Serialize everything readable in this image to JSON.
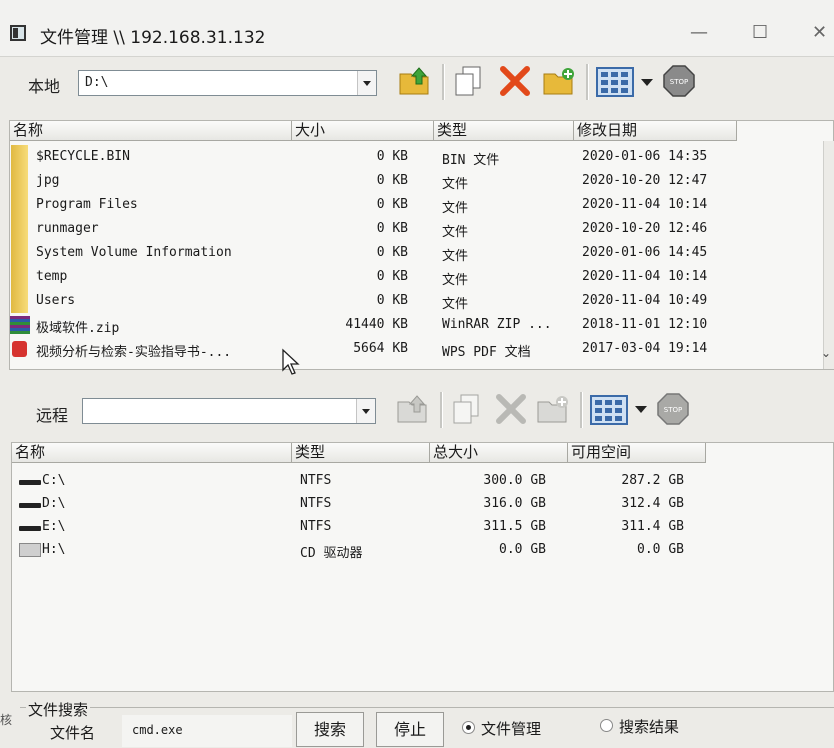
{
  "window": {
    "title": "文件管理 \\\\ 192.168.31.132",
    "minimize": "—",
    "maximize": "☐",
    "close": "✕"
  },
  "local": {
    "label": "本地",
    "path": "D:\\",
    "columns": [
      "名称",
      "大小",
      "类型",
      "修改日期"
    ],
    "files": [
      {
        "icon": "folder-icon",
        "name": "$RECYCLE.BIN",
        "size": "0 KB",
        "type": "BIN 文件",
        "date": "2020-01-06 14:35"
      },
      {
        "icon": "folder-icon",
        "name": "jpg",
        "size": "0 KB",
        "type": "文件",
        "date": "2020-10-20 12:47"
      },
      {
        "icon": "folder-icon",
        "name": "Program Files",
        "size": "0 KB",
        "type": "文件",
        "date": "2020-11-04 10:14"
      },
      {
        "icon": "folder-icon",
        "name": "runmager",
        "size": "0 KB",
        "type": "文件",
        "date": "2020-10-20 12:46"
      },
      {
        "icon": "folder-icon",
        "name": "System Volume Information",
        "size": "0 KB",
        "type": "文件",
        "date": "2020-01-06 14:45"
      },
      {
        "icon": "folder-icon",
        "name": "temp",
        "size": "0 KB",
        "type": "文件",
        "date": "2020-11-04 10:14"
      },
      {
        "icon": "folder-icon",
        "name": "Users",
        "size": "0 KB",
        "type": "文件",
        "date": "2020-11-04 10:49"
      },
      {
        "icon": "zip-icon",
        "name": "极域软件.zip",
        "size": "41440 KB",
        "type": "WinRAR ZIP ...",
        "date": "2018-11-01 12:10"
      },
      {
        "icon": "pdf-icon",
        "name": "视频分析与检索-实验指导书-...",
        "size": "5664 KB",
        "type": "WPS PDF 文档",
        "date": "2017-03-04 19:14"
      }
    ],
    "stop_label": "STOP"
  },
  "remote": {
    "label": "远程",
    "path": "",
    "columns": [
      "名称",
      "类型",
      "总大小",
      "可用空间"
    ],
    "drives": [
      {
        "icon": "drive-icon",
        "name": "C:\\",
        "type": "NTFS",
        "total": "300.0 GB",
        "free": "287.2 GB"
      },
      {
        "icon": "drive-icon",
        "name": "D:\\",
        "type": "NTFS",
        "total": "316.0 GB",
        "free": "312.4 GB"
      },
      {
        "icon": "drive-icon",
        "name": "E:\\",
        "type": "NTFS",
        "total": "311.5 GB",
        "free": "311.4 GB"
      },
      {
        "icon": "cd-drive-icon",
        "name": "H:\\",
        "type": "CD 驱动器",
        "total": "0.0 GB",
        "free": "0.0 GB"
      }
    ],
    "stop_label": "STOP"
  },
  "search": {
    "group_label": "文件搜索",
    "filename_label": "文件名",
    "filename_value": "cmd.exe",
    "search_button": "搜索",
    "stop_button": "停止",
    "radio_file_manage": "文件管理",
    "radio_search_results": "搜索结果",
    "edge_fragment": "核"
  }
}
